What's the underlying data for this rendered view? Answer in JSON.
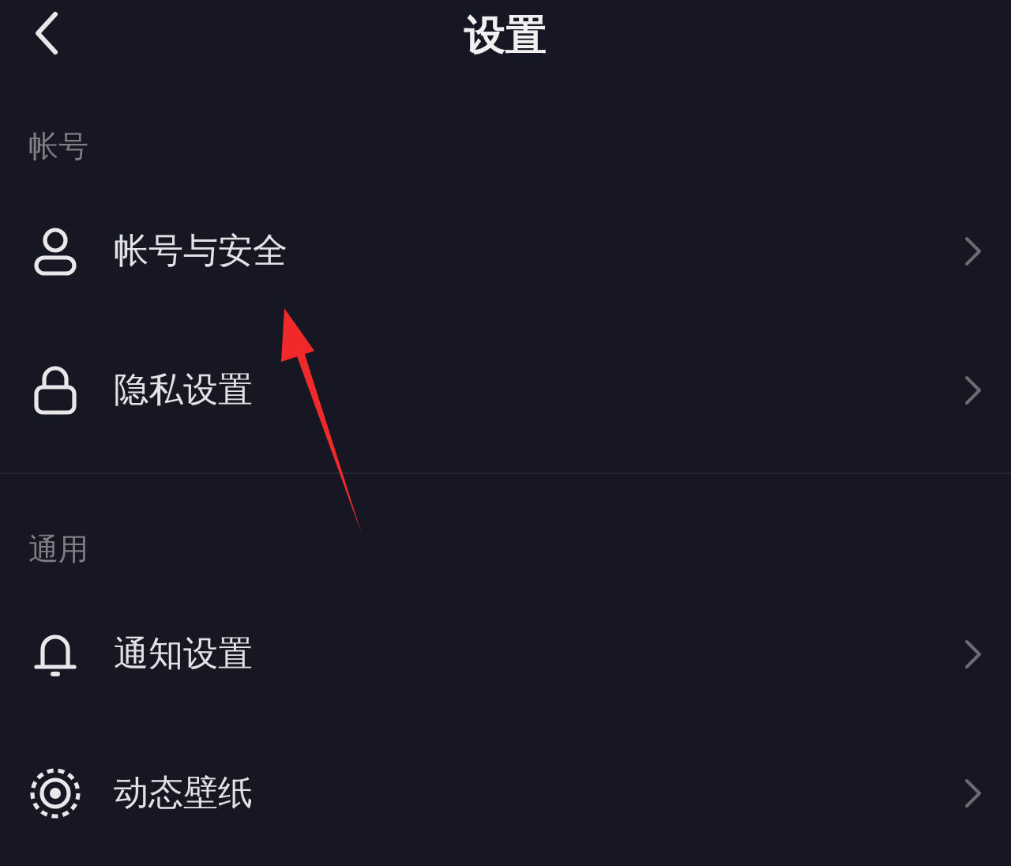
{
  "header": {
    "title": "设置"
  },
  "sections": [
    {
      "title": "帐号",
      "items": [
        {
          "kind": "account",
          "label": "帐号与安全"
        },
        {
          "kind": "privacy",
          "label": "隐私设置"
        }
      ]
    },
    {
      "title": "通用",
      "items": [
        {
          "kind": "notification",
          "label": "通知设置"
        },
        {
          "kind": "wallpaper",
          "label": "动态壁纸"
        }
      ]
    }
  ],
  "annotations": [
    {
      "kind": "arrow"
    }
  ]
}
